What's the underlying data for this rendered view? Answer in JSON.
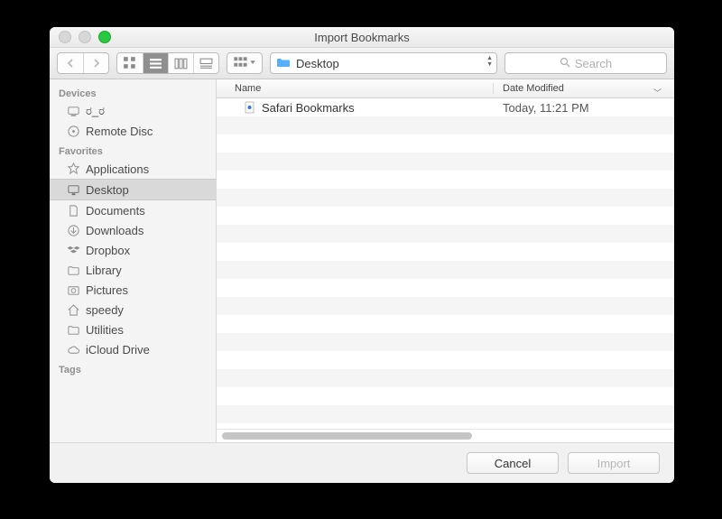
{
  "window": {
    "title": "Import Bookmarks"
  },
  "toolbar": {
    "location_label": "Desktop",
    "search_placeholder": "Search"
  },
  "sidebar": {
    "sections": [
      {
        "head": "Devices",
        "items": [
          {
            "icon": "computer-icon",
            "label": "ರ_ರ"
          },
          {
            "icon": "disc-icon",
            "label": "Remote Disc"
          }
        ]
      },
      {
        "head": "Favorites",
        "items": [
          {
            "icon": "apps-icon",
            "label": "Applications"
          },
          {
            "icon": "desktop-icon",
            "label": "Desktop",
            "selected": true
          },
          {
            "icon": "documents-icon",
            "label": "Documents"
          },
          {
            "icon": "downloads-icon",
            "label": "Downloads"
          },
          {
            "icon": "dropbox-icon",
            "label": "Dropbox"
          },
          {
            "icon": "folder-icon",
            "label": "Library"
          },
          {
            "icon": "pictures-icon",
            "label": "Pictures"
          },
          {
            "icon": "home-icon",
            "label": "speedy"
          },
          {
            "icon": "folder-icon",
            "label": "Utilities"
          },
          {
            "icon": "cloud-icon",
            "label": "iCloud Drive"
          }
        ]
      },
      {
        "head": "Tags",
        "items": []
      }
    ]
  },
  "columns": {
    "name": "Name",
    "date": "Date Modified"
  },
  "files": [
    {
      "name": "Safari Bookmarks",
      "date": "Today, 11:21 PM"
    }
  ],
  "buttons": {
    "cancel": "Cancel",
    "import": "Import"
  }
}
